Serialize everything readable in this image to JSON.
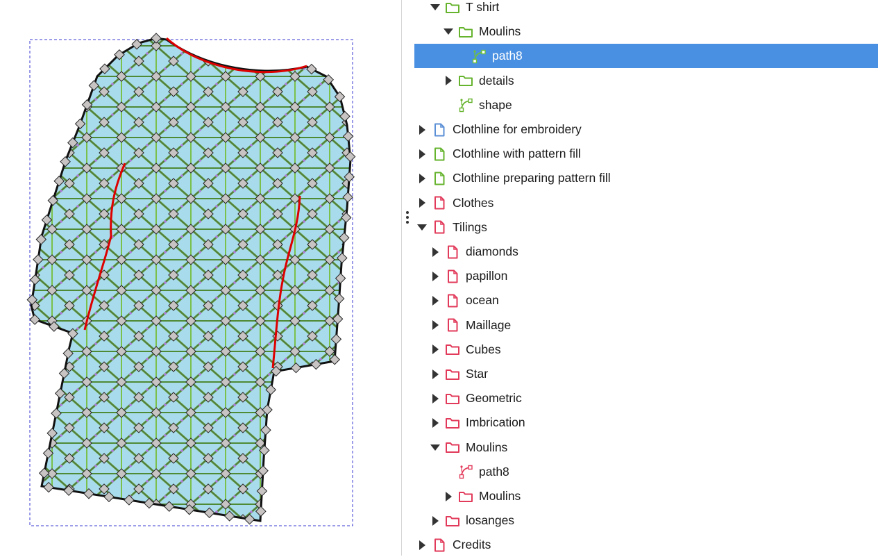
{
  "colors": {
    "green": "#66b32e",
    "blue": "#5b8fd6",
    "red": "#e23a5a",
    "selection": "#4a90e2",
    "shirt_fill": "#a8dcec",
    "seam": "#dd0000"
  },
  "layers": [
    {
      "label": "T shirt",
      "depth": 1,
      "expander": "down",
      "icon": "folder",
      "color": "green"
    },
    {
      "label": "Moulins",
      "depth": 2,
      "expander": "down",
      "icon": "folder",
      "color": "green"
    },
    {
      "label": "path8",
      "depth": 3,
      "expander": "none",
      "icon": "path",
      "color": "green",
      "selected": true
    },
    {
      "label": "details",
      "depth": 2,
      "expander": "right",
      "icon": "folder",
      "color": "green"
    },
    {
      "label": "shape",
      "depth": 2,
      "expander": "none",
      "icon": "path",
      "color": "green"
    },
    {
      "label": "Clothline for embroidery",
      "depth": 0,
      "expander": "right",
      "icon": "page",
      "color": "blue"
    },
    {
      "label": "Clothline  with pattern fill",
      "depth": 0,
      "expander": "right",
      "icon": "page",
      "color": "green"
    },
    {
      "label": "Clothline  preparing pattern fill",
      "depth": 0,
      "expander": "right",
      "icon": "page",
      "color": "green"
    },
    {
      "label": "Clothes",
      "depth": 0,
      "expander": "right",
      "icon": "page",
      "color": "red"
    },
    {
      "label": "Tilings",
      "depth": 0,
      "expander": "down",
      "icon": "page",
      "color": "red"
    },
    {
      "label": "diamonds",
      "depth": 1,
      "expander": "right",
      "icon": "page",
      "color": "red"
    },
    {
      "label": "papillon",
      "depth": 1,
      "expander": "right",
      "icon": "page",
      "color": "red"
    },
    {
      "label": "ocean",
      "depth": 1,
      "expander": "right",
      "icon": "page",
      "color": "red"
    },
    {
      "label": "Maillage",
      "depth": 1,
      "expander": "right",
      "icon": "page",
      "color": "red"
    },
    {
      "label": "Cubes",
      "depth": 1,
      "expander": "right",
      "icon": "folder",
      "color": "red"
    },
    {
      "label": "Star",
      "depth": 1,
      "expander": "right",
      "icon": "folder",
      "color": "red"
    },
    {
      "label": "Geometric",
      "depth": 1,
      "expander": "right",
      "icon": "folder",
      "color": "red"
    },
    {
      "label": "Imbrication",
      "depth": 1,
      "expander": "right",
      "icon": "folder",
      "color": "red"
    },
    {
      "label": "Moulins",
      "depth": 1,
      "expander": "down",
      "icon": "folder",
      "color": "red"
    },
    {
      "label": "path8",
      "depth": 2,
      "expander": "none",
      "icon": "path",
      "color": "red"
    },
    {
      "label": "Moulins",
      "depth": 2,
      "expander": "right",
      "icon": "folder",
      "color": "red"
    },
    {
      "label": "losanges",
      "depth": 1,
      "expander": "right",
      "icon": "folder",
      "color": "red"
    },
    {
      "label": "Credits",
      "depth": 0,
      "expander": "right",
      "icon": "page",
      "color": "red"
    }
  ]
}
